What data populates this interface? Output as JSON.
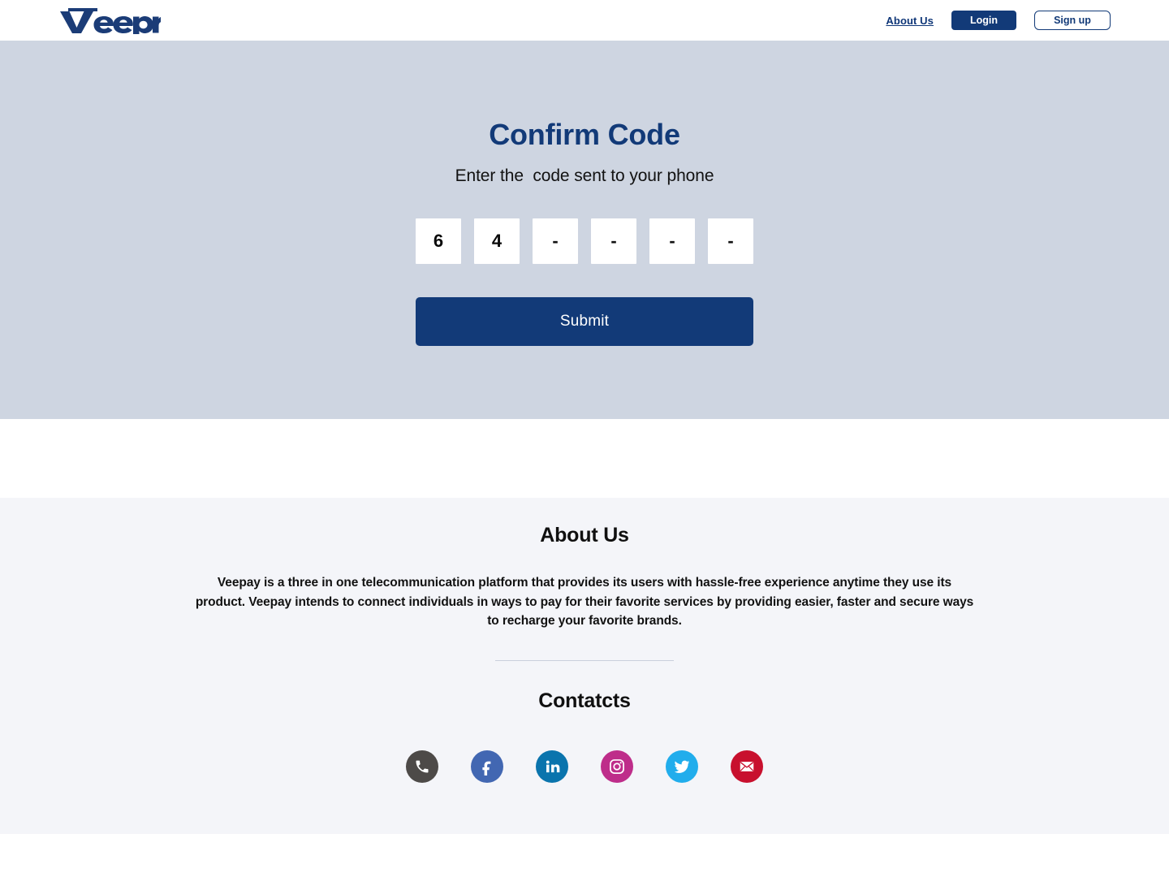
{
  "brand": {
    "name": "Veepay",
    "logo_color": "#1B3C77"
  },
  "header": {
    "about_link": "About Us",
    "login_label": "Login",
    "signup_label": "Sign up"
  },
  "hero": {
    "title": "Confirm Code",
    "subtitle": "Enter the  code sent to your phone",
    "code_digits": [
      "6",
      "4",
      "-",
      "-",
      "-",
      "-"
    ],
    "submit_label": "Submit",
    "background_color": "#CED5E1",
    "accent_color": "#123A78"
  },
  "footer": {
    "about_title": "About Us",
    "about_body": "Veepay is a three in one telecommunication platform that provides its users with hassle-free experience anytime they use its product. Veepay intends to connect individuals in ways to pay for their favorite services by providing easier, faster and secure ways to recharge your favorite brands.",
    "contacts_title": "Contatcts",
    "background_color": "#F4F5F9",
    "socials": [
      {
        "name": "phone-icon",
        "label": "Phone",
        "color": "#4D4A48"
      },
      {
        "name": "facebook-icon",
        "label": "Facebook",
        "color": "#4267B2"
      },
      {
        "name": "linkedin-icon",
        "label": "LinkedIn",
        "color": "#0A74AD"
      },
      {
        "name": "instagram-icon",
        "label": "Instagram",
        "color": "#BE2D8A"
      },
      {
        "name": "twitter-icon",
        "label": "Twitter",
        "color": "#21ADEC"
      },
      {
        "name": "email-icon",
        "label": "Email",
        "color": "#C8102E"
      }
    ]
  }
}
